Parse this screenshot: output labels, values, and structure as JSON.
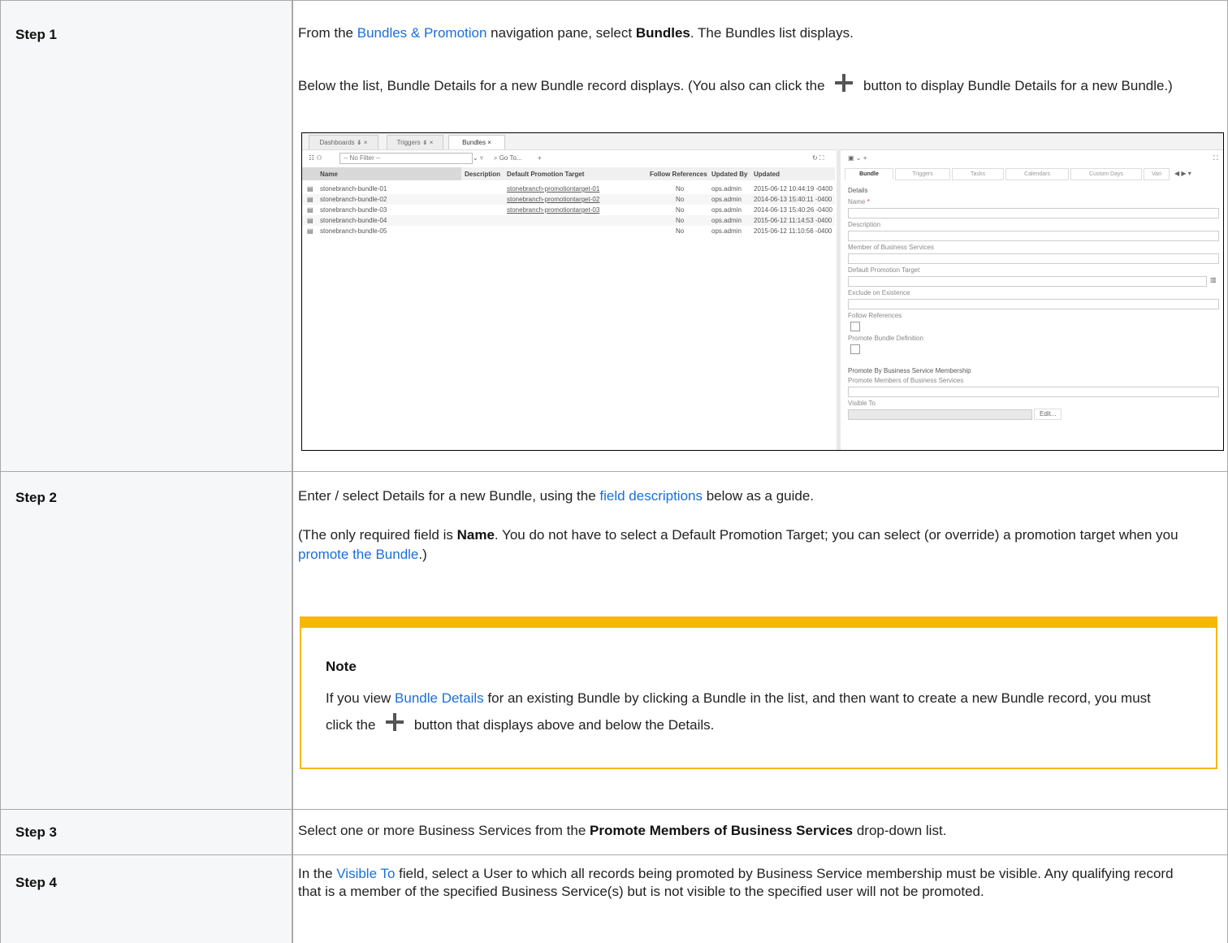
{
  "steps": [
    {
      "label": "Step 1"
    },
    {
      "label": "Step 2"
    },
    {
      "label": "Step 3"
    },
    {
      "label": "Step 4"
    }
  ],
  "step1": {
    "p1_a": "From the ",
    "p1_link": "Bundles & Promotion",
    "p1_b": " navigation pane, select ",
    "p1_bold": "Bundles",
    "p1_c": ". The Bundles list displays.",
    "p2_a": "Below the list, Bundle Details for a new Bundle record displays. (You also can click the ",
    "p2_b": " button to display Bundle Details for a new Bundle.)"
  },
  "shot": {
    "tabs": [
      "Dashboards",
      "Triggers",
      "Bundles"
    ],
    "filter": "-- No Filter --",
    "goto": "Go To...",
    "grid_headers": [
      "Name",
      "Description",
      "Default Promotion Target",
      "Follow References",
      "Updated By",
      "Updated"
    ],
    "rows": [
      {
        "name": "stonebranch-bundle-01",
        "target": "stonebranch-promotiontarget-01",
        "follow": "No",
        "by": "ops.admin",
        "updated": "2015-06-12 10:44:19 -0400"
      },
      {
        "name": "stonebranch-bundle-02",
        "target": "stonebranch-promotiontarget-02",
        "follow": "No",
        "by": "ops.admin",
        "updated": "2014-06-13 15:40:11 -0400"
      },
      {
        "name": "stonebranch-bundle-03",
        "target": "stonebranch-promotiontarget-03",
        "follow": "No",
        "by": "ops.admin",
        "updated": "2014-06-13 15:40:26 -0400"
      },
      {
        "name": "stonebranch-bundle-04",
        "target": "",
        "follow": "No",
        "by": "ops.admin",
        "updated": "2015-06-12 11:14:53 -0400"
      },
      {
        "name": "stonebranch-bundle-05",
        "target": "",
        "follow": "No",
        "by": "ops.admin",
        "updated": "2015-06-12 11:10:56 -0400"
      }
    ],
    "detail_tabs": [
      "Bundle",
      "Triggers",
      "Tasks",
      "Calendars",
      "Custom Days",
      "Vari"
    ],
    "details_title": "Details",
    "fields": {
      "name": "Name",
      "description": "Description",
      "member": "Member of Business Services",
      "target": "Default Promotion Target",
      "exclude": "Exclude on Existence",
      "follow": "Follow References",
      "promote_def": "Promote Bundle Definition",
      "section": "Promote By Business Service Membership",
      "promote_members": "Promote Members of Business Services",
      "visible": "Visible To",
      "edit": "Edit..."
    }
  },
  "step2": {
    "p1_a": "Enter / select Details for a new Bundle, using the ",
    "p1_link": "field descriptions",
    "p1_b": " below as a guide.",
    "p2_a": "(The only required field is ",
    "p2_bold": "Name",
    "p2_b": ". You do not have to select a Default Promotion Target; you can select (or override) a promotion target when you ",
    "p2_link": "promote the Bundle",
    "p2_c": ".)",
    "note_title": "Note",
    "note_a": "If you view ",
    "note_link": "Bundle Details",
    "note_b": " for an existing Bundle by clicking a Bundle in the list, and then want to create a new Bundle record, you must click the ",
    "note_c": " button that displays above and below the Details."
  },
  "step3": {
    "a": "Select one or more Business Services from the ",
    "bold": "Promote Members of Business Services",
    "b": " drop-down list."
  },
  "step4": {
    "a": "In the ",
    "link": "Visible To",
    "b": " field, select a User to which all records being promoted by Business Service membership must be visible. Any qualifying record that is a member of the specified Business Service(s) but is not visible to the specified user will not be promoted."
  }
}
